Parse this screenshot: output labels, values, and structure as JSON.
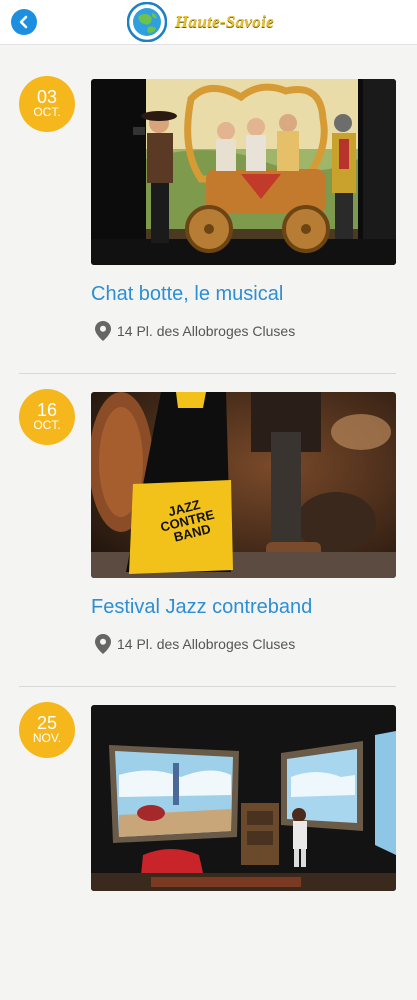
{
  "header": {
    "back_icon": "back-arrow-icon",
    "logo_text": "Haute-Savoie",
    "accent_color": "#1d8fe0",
    "logo_text_color": "#e7c030"
  },
  "events": [
    {
      "day": "03",
      "month": "OCT.",
      "title": "Chat botte, le musical",
      "location": "14 Pl. des Allobroges Cluses"
    },
    {
      "day": "16",
      "month": "OCT.",
      "title": "Festival Jazz contreband",
      "location": "14 Pl. des Allobroges Cluses",
      "poster_text": "JAZZ CONTRE BAND"
    },
    {
      "day": "25",
      "month": "NOV.",
      "title": "",
      "location": ""
    }
  ],
  "colors": {
    "badge": "#f6b71d",
    "title": "#2c8fd6",
    "background": "#f4f4f2"
  }
}
